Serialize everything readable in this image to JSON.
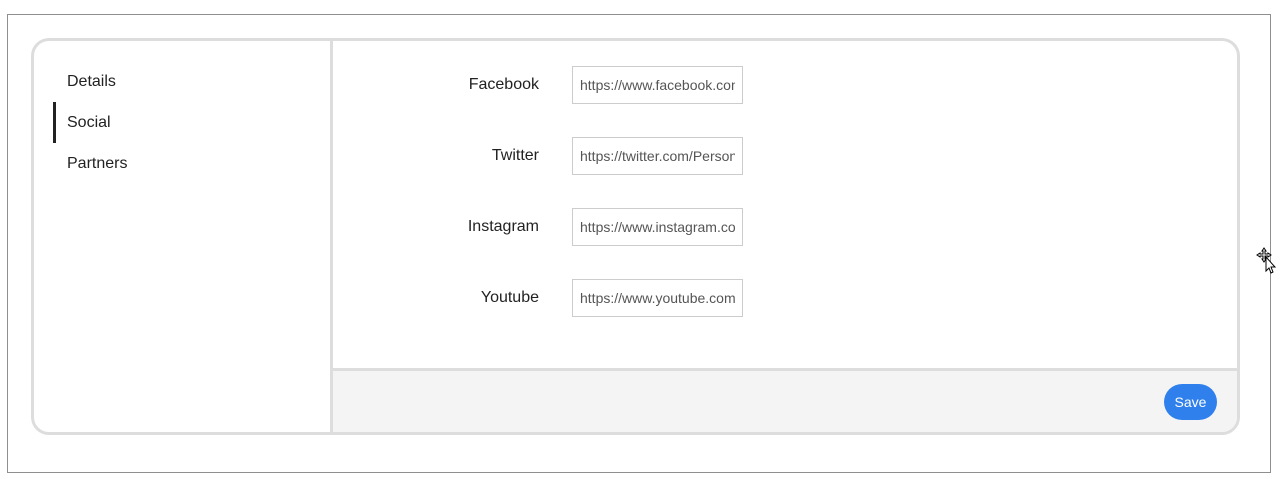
{
  "sidebar": {
    "items": [
      {
        "label": "Details",
        "active": false
      },
      {
        "label": "Social",
        "active": true
      },
      {
        "label": "Partners",
        "active": false
      }
    ]
  },
  "form": {
    "fields": [
      {
        "label": "Facebook",
        "value": "https://www.facebook.com/PersonaTheme"
      },
      {
        "label": "Twitter",
        "value": "https://twitter.com/PersonaTheme"
      },
      {
        "label": "Instagram",
        "value": "https://www.instagram.com/PersonaTheme"
      },
      {
        "label": "Youtube",
        "value": "https://www.youtube.com/PersonaTheme"
      }
    ]
  },
  "footer": {
    "save_label": "Save"
  },
  "colors": {
    "accent": "#2f80ed",
    "border": "#dddddd",
    "footer_bg": "#f4f4f4"
  },
  "icons": {
    "cursor": "move-cursor-icon"
  }
}
